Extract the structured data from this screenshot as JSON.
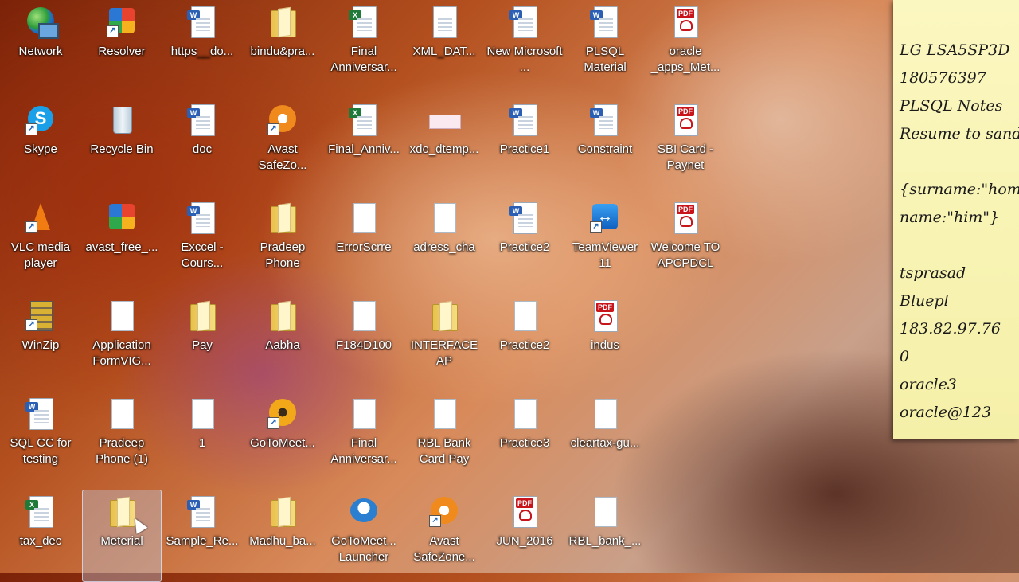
{
  "desktop": {
    "icons": [
      {
        "label": "Network",
        "type": "network",
        "col": 0,
        "row": 0
      },
      {
        "label": "Resolver",
        "type": "colorful",
        "col": 1,
        "row": 0,
        "shortcut": true
      },
      {
        "label": "https__do...",
        "type": "word",
        "col": 2,
        "row": 0
      },
      {
        "label": "bindu&pra...",
        "type": "folder",
        "col": 3,
        "row": 0
      },
      {
        "label": "Final Anniversar...",
        "type": "excel",
        "col": 4,
        "row": 0
      },
      {
        "label": "XML_DAT...",
        "type": "web",
        "col": 5,
        "row": 0
      },
      {
        "label": "New Microsoft ...",
        "type": "word",
        "col": 6,
        "row": 0
      },
      {
        "label": "PLSQL Material",
        "type": "word",
        "col": 7,
        "row": 0
      },
      {
        "label": "oracle _apps_Met...",
        "type": "pdf",
        "col": 8,
        "row": 0
      },
      {
        "label": "Skype",
        "type": "skype",
        "col": 0,
        "row": 1,
        "shortcut": true
      },
      {
        "label": "Recycle Bin",
        "type": "bin",
        "col": 1,
        "row": 1
      },
      {
        "label": "doc",
        "type": "word",
        "col": 2,
        "row": 1
      },
      {
        "label": "Avast SafeZo...",
        "type": "avast",
        "col": 3,
        "row": 1,
        "shortcut": true
      },
      {
        "label": "Final_Anniv...",
        "type": "excel",
        "col": 4,
        "row": 1
      },
      {
        "label": "xdo_dtemp...",
        "type": "xdo",
        "col": 5,
        "row": 1
      },
      {
        "label": "Practice1",
        "type": "word",
        "col": 6,
        "row": 1
      },
      {
        "label": "Constraint",
        "type": "word",
        "col": 7,
        "row": 1
      },
      {
        "label": "SBI Card - Paynet",
        "type": "pdf",
        "col": 8,
        "row": 1
      },
      {
        "label": "VLC media player",
        "type": "vlc",
        "col": 0,
        "row": 2,
        "shortcut": true
      },
      {
        "label": "avast_free_...",
        "type": "colorful",
        "col": 1,
        "row": 2
      },
      {
        "label": "Exccel - Cours...",
        "type": "word",
        "col": 2,
        "row": 2
      },
      {
        "label": "Pradeep Phone",
        "type": "folder",
        "col": 3,
        "row": 2
      },
      {
        "label": "ErrorScrre",
        "type": "blank",
        "col": 4,
        "row": 2
      },
      {
        "label": "adress_cha",
        "type": "blank",
        "col": 5,
        "row": 2
      },
      {
        "label": "Practice2",
        "type": "word",
        "col": 6,
        "row": 2
      },
      {
        "label": "TeamViewer 11",
        "type": "teamviewer",
        "col": 7,
        "row": 2,
        "shortcut": true
      },
      {
        "label": "Welcome TO APCPDCL",
        "type": "pdf",
        "col": 8,
        "row": 2
      },
      {
        "label": "WinZip",
        "type": "zip",
        "col": 0,
        "row": 3,
        "shortcut": true
      },
      {
        "label": "Application FormVIG...",
        "type": "blank",
        "col": 1,
        "row": 3
      },
      {
        "label": "Pay",
        "type": "folder",
        "col": 2,
        "row": 3
      },
      {
        "label": "Aabha",
        "type": "folder",
        "col": 3,
        "row": 3
      },
      {
        "label": "F184D100",
        "type": "blank",
        "col": 4,
        "row": 3
      },
      {
        "label": "INTERFACE AP",
        "type": "folder",
        "col": 5,
        "row": 3
      },
      {
        "label": "Practice2",
        "type": "blank",
        "col": 6,
        "row": 3
      },
      {
        "label": "indus",
        "type": "pdf",
        "col": 7,
        "row": 3
      },
      {
        "label": "SQL CC for testing",
        "type": "word",
        "col": 0,
        "row": 4
      },
      {
        "label": "Pradeep Phone (1)",
        "type": "blank",
        "col": 1,
        "row": 4
      },
      {
        "label": "1",
        "type": "blank",
        "col": 2,
        "row": 4
      },
      {
        "label": "GoToMeet...",
        "type": "gotomeeting",
        "col": 3,
        "row": 4,
        "shortcut": true
      },
      {
        "label": "Final Anniversar...",
        "type": "blank",
        "col": 4,
        "row": 4
      },
      {
        "label": "RBL Bank Card Pay",
        "type": "blank",
        "col": 5,
        "row": 4
      },
      {
        "label": "Practice3",
        "type": "blank",
        "col": 6,
        "row": 4
      },
      {
        "label": "cleartax-gu...",
        "type": "blank",
        "col": 7,
        "row": 4
      },
      {
        "label": "tax_dec",
        "type": "excel",
        "col": 0,
        "row": 5
      },
      {
        "label": "Meterial",
        "type": "folder",
        "col": 1,
        "row": 5,
        "selected": true
      },
      {
        "label": "Sample_Re...",
        "type": "word",
        "col": 2,
        "row": 5
      },
      {
        "label": "Madhu_ba...",
        "type": "folder",
        "col": 3,
        "row": 5
      },
      {
        "label": "GoToMeet... Launcher",
        "type": "launcher",
        "col": 4,
        "row": 5
      },
      {
        "label": "Avast SafeZone...",
        "type": "avast",
        "col": 5,
        "row": 5,
        "shortcut": true
      },
      {
        "label": "JUN_2016",
        "type": "pdf",
        "col": 6,
        "row": 5
      },
      {
        "label": "RBL_bank_...",
        "type": "blank",
        "col": 7,
        "row": 5
      }
    ]
  },
  "sticky_note": {
    "lines": [
      "LG LSA5SP3D",
      "180576397",
      "PLSQL Notes",
      "Resume to sandeep",
      "",
      "{surname:\"homer\"",
      "name:\"him\"}",
      "",
      "tsprasad",
      "Bluepl",
      "183.82.97.76",
      "0",
      "oracle3",
      "oracle@123"
    ]
  }
}
